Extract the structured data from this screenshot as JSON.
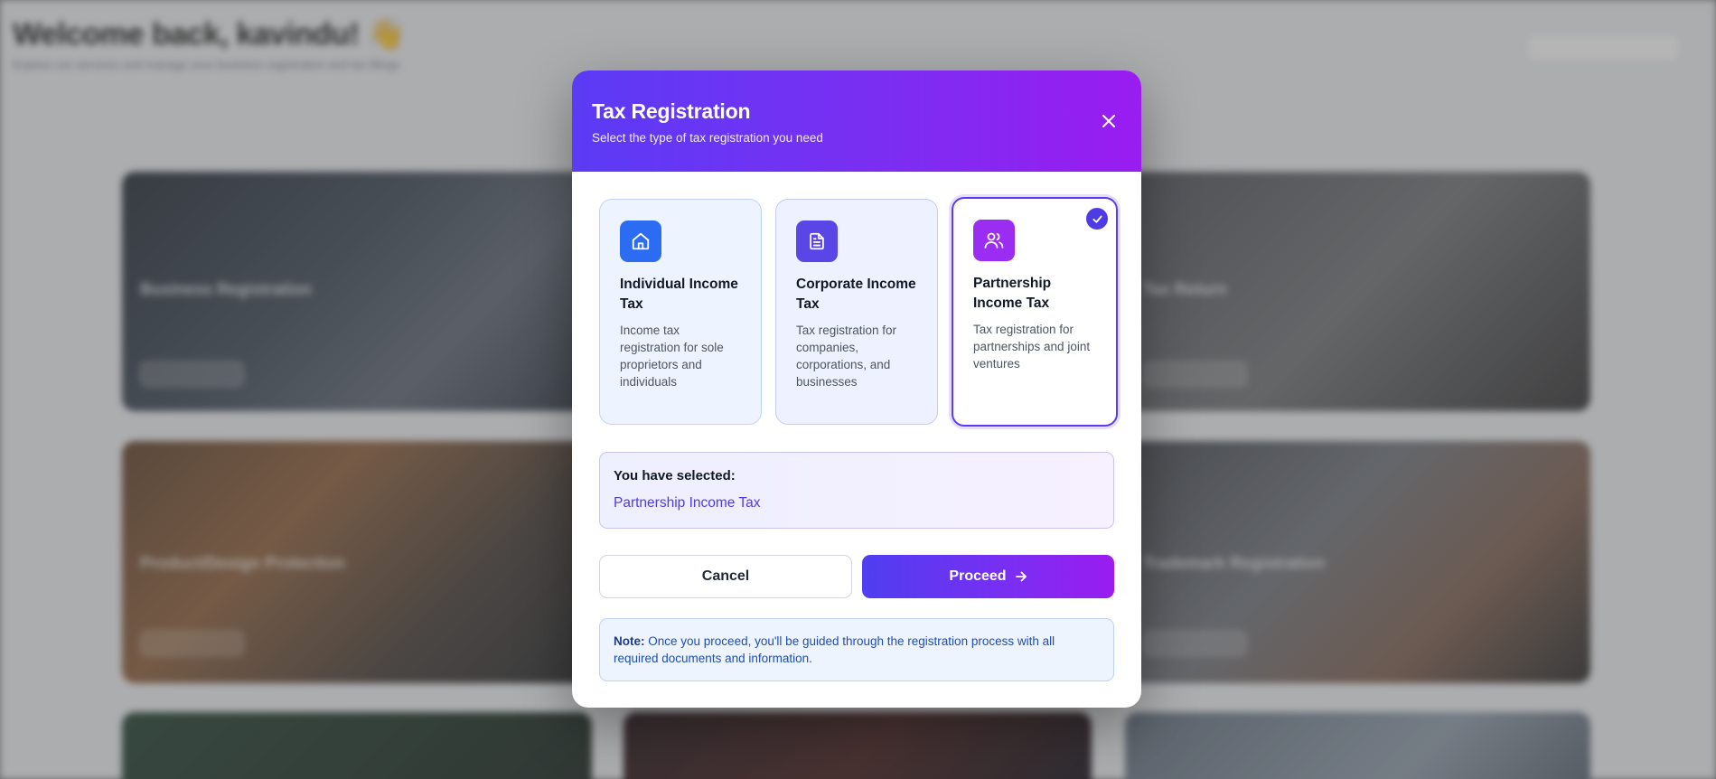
{
  "background": {
    "welcome": "Welcome back, kavindu! 👋",
    "subtitle": "Explore our services and manage your business registration and tax filings",
    "cards": [
      {
        "title": "Business Registration"
      },
      {
        "title": "Tax Return"
      },
      {
        "title": "Product/Design Protection"
      },
      {
        "title": "Trademark Registration"
      }
    ]
  },
  "modal": {
    "title": "Tax Registration",
    "subtitle": "Select the type of tax registration you need",
    "options": [
      {
        "icon": "home-icon",
        "title": "Individual Income Tax",
        "description": "Income tax registration for sole proprietors and individuals",
        "selected": false
      },
      {
        "icon": "document-icon",
        "title": "Corporate Income Tax",
        "description": "Tax registration for companies, corporations, and businesses",
        "selected": false
      },
      {
        "icon": "users-icon",
        "title": "Partnership Income Tax",
        "description": "Tax registration for partnerships and joint ventures",
        "selected": true
      }
    ],
    "summary": {
      "label": "You have selected:",
      "value": "Partnership Income Tax"
    },
    "buttons": {
      "cancel": "Cancel",
      "proceed": "Proceed"
    },
    "note": {
      "label": "Note:",
      "text": "Once you proceed, you'll be guided through the registration process with all required documents and information."
    }
  },
  "colors": {
    "accent": "#5b3bf5",
    "accent_end": "#9a1cf0",
    "selected_text": "#4f3be6",
    "note_text": "#1e4db7"
  }
}
